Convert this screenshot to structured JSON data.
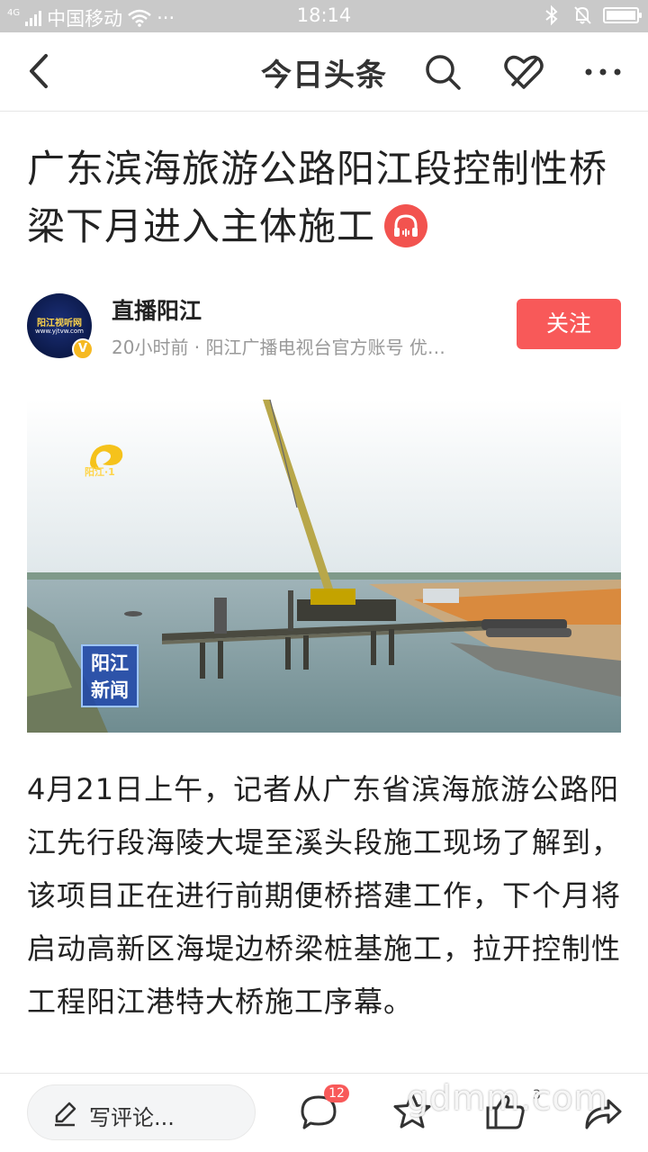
{
  "status_bar": {
    "network": "4G",
    "carrier": "中国移动",
    "more": "···",
    "time": "18:14"
  },
  "nav": {
    "title": "今日头条"
  },
  "article": {
    "title": "广东滨海旅游公路阳江段控制性桥梁下月进入主体施工",
    "author": {
      "name": "直播阳江",
      "meta": "20小时前 · 阳江广播电视台官方账号 优…",
      "avatar_text": "阳江视听网",
      "avatar_url_text": "www.yjtvw.com",
      "verified_mark": "V"
    },
    "follow_label": "关注",
    "image": {
      "logo_text": "阳江·1",
      "news_logo": "阳江新闻"
    },
    "body": "4月21日上午，记者从广东省滨海旅游公路阳江先行段海陵大堤至溪头段施工现场了解到，该项目正在进行前期便桥搭建工作，下个月将启动高新区海堤边桥梁桩基施工，拉开控制性工程阳江港特大桥施工序幕。"
  },
  "bottom_bar": {
    "comment_placeholder": "写评论...",
    "comment_count": "12",
    "like_count": "3"
  },
  "watermark": "gdmm.com",
  "colors": {
    "accent_red": "#f85959",
    "status_bar_bg": "#c9c9c9",
    "audio_icon_bg": "#f2534f"
  },
  "icons": [
    "back-icon",
    "search-icon",
    "favorite-off-icon",
    "more-icon",
    "headphones-icon",
    "pen-icon",
    "comment-icon",
    "star-icon",
    "thumbs-up-icon",
    "share-icon"
  ]
}
